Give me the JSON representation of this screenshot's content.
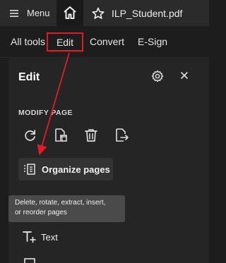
{
  "titlebar": {
    "menu_label": "Menu",
    "menu_icon": "hamburger-icon",
    "home_icon": "home-icon",
    "tab_title": "ILP_Student.pdf",
    "star_icon": "star-icon"
  },
  "toolbar": {
    "tabs": [
      {
        "label": "All tools"
      },
      {
        "label": "Edit",
        "selected": true
      },
      {
        "label": "Convert"
      },
      {
        "label": "E-Sign"
      }
    ]
  },
  "panel": {
    "title": "Edit",
    "settings_icon": "gear-icon",
    "close_icon": "close-icon",
    "section_label": "MODIFY PAGE",
    "page_tools": [
      {
        "icon": "rotate-icon"
      },
      {
        "icon": "crop-page-icon"
      },
      {
        "icon": "trash-icon"
      },
      {
        "icon": "extract-page-icon"
      }
    ],
    "organize_label": "Organize pages",
    "organize_icon": "organize-pages-icon",
    "tooltip_line1": "Delete, rotate, extract, insert,",
    "tooltip_line2": "or reorder pages",
    "text_tool_label": "Text",
    "text_tool_icon": "add-text-icon",
    "image_tool_icon": "image-icon"
  },
  "colors": {
    "background": "#1d1d1d",
    "panel": "#252525",
    "highlight": "#e01c24"
  }
}
